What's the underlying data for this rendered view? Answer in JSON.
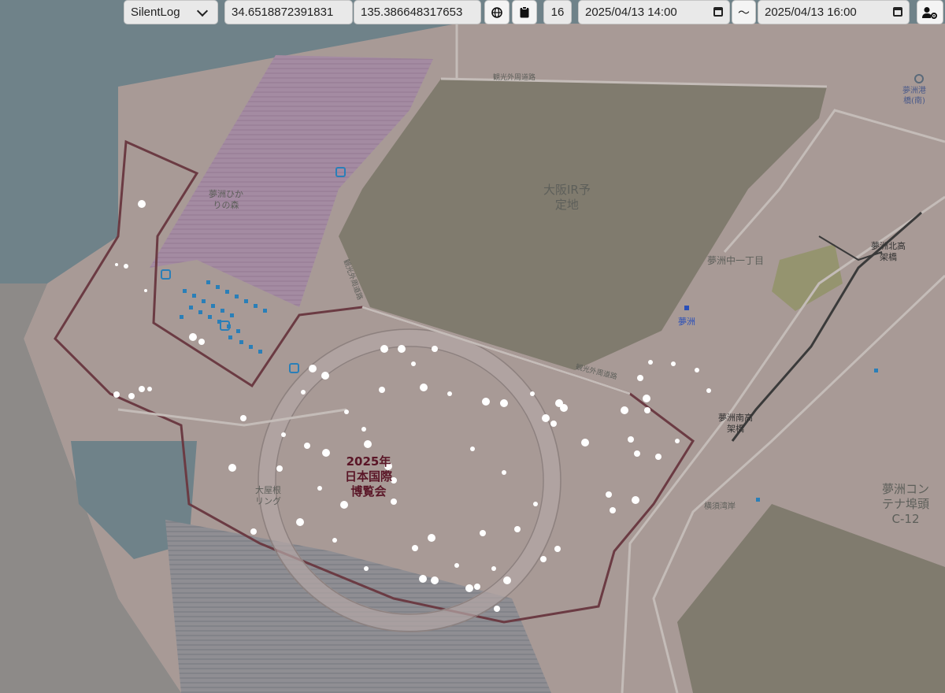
{
  "toolbar": {
    "log_select": "SilentLog",
    "latitude": "34.6518872391831",
    "longitude": "135.386648317653",
    "zoom": "16",
    "start_datetime": "2025/04/13 14:00",
    "range_separator": "〜",
    "end_datetime": "2025/04/13 16:00",
    "icons": [
      "globe-icon",
      "clipboard-icon",
      "calendar-icon",
      "user-settings-icon"
    ]
  },
  "map_labels": {
    "ir_site": "大阪IR予\n定地",
    "expo": "2025年\n日本国際\n博覧会",
    "yumeshima_1chome": "夢洲中一丁目",
    "yumeshima_station": "夢洲",
    "container_terminal": "夢洲コン\nテナ埠頭\nC-12",
    "north_bridge": "夢洲北高\n架橋",
    "south_bridge": "夢洲南高\n架橋",
    "grand_ring": "大屋根\nリング",
    "forest": "夢洲ひか\nりの森",
    "top_right": "夢洲港\n橋(南)",
    "road_north": "観光外周道路",
    "road_west": "観光外周道路",
    "road_south": "観光外周道路",
    "yokobori": "横須湾岸"
  },
  "colors": {
    "water": "#6f8289",
    "land": "#a89a96",
    "ir_site": "#807b6e",
    "green_area": "#95946f",
    "boundary": "#6b3b43",
    "marker_white": "#ffffff",
    "marker_blue": "#2a7fb8"
  }
}
